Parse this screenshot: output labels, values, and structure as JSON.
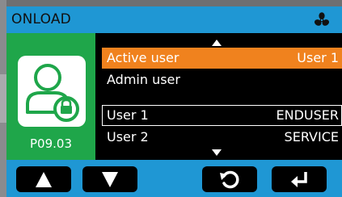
{
  "header": {
    "title": "ONLOAD",
    "status_icon": "fan-icon"
  },
  "user_panel": {
    "icon": "user-lock-icon",
    "code": "P09.03"
  },
  "list": {
    "scroll_up_icon": "triangle-up-icon",
    "scroll_down_icon": "triangle-down-icon",
    "items": [
      {
        "label": "Active user",
        "value": "User 1",
        "state": "highlighted"
      },
      {
        "label": "Admin user",
        "value": "",
        "state": "normal"
      },
      {
        "label": "User 1",
        "value": "ENDUSER",
        "state": "selected"
      },
      {
        "label": "User 2",
        "value": "SERVICE",
        "state": "normal"
      }
    ]
  },
  "buttons": {
    "up_icon": "triangle-up-icon",
    "down_icon": "triangle-down-icon",
    "back_icon": "undo-icon",
    "enter_icon": "enter-icon"
  },
  "colors": {
    "header": "#1f97d4",
    "panel": "#1fa64a",
    "highlight": "#f0821e"
  }
}
